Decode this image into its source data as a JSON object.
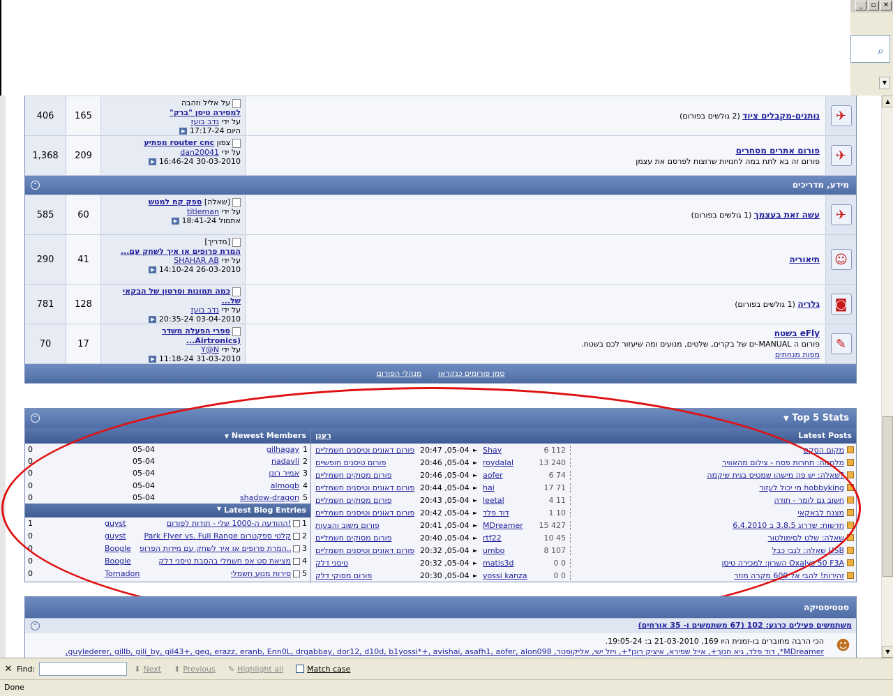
{
  "window": {
    "minimize": "_",
    "maximize": "▫",
    "close": "✕"
  },
  "forum_rows_a": [
    {
      "title": "נותנים-מקבלים ציוד",
      "viewers": "(2 גולשים בפורום)",
      "desc": "",
      "last_line1": "על אליל וזהבה",
      "last_title": "למסירה טיסן \"ברק\"",
      "last_by_prefix": "על ידי",
      "last_by": "נדב בועז",
      "last_date": "היום",
      "last_time": "17:17-24",
      "threads": "165",
      "posts": "406"
    },
    {
      "title": "פורום אתרים מסחרים",
      "viewers": "",
      "desc": "פורום זה בא לתת במה לחנויות שרוצות לפרסם את עצמן",
      "last_line1": "צפון",
      "last_title": "router cnc מפתיע",
      "last_by_prefix": "על ידי",
      "last_by": "dan20041",
      "last_date": "30-03-2010",
      "last_time": "16:46-24",
      "threads": "209",
      "posts": "1,368"
    }
  ],
  "category": {
    "title": "מידע, מדריכים",
    "collapse": "⌃"
  },
  "forum_rows_b": [
    {
      "title": "עשה זאת בעצמך",
      "viewers": "(1 גולשים בפורום)",
      "desc": "",
      "desc2": "",
      "prefix": "[שאלה]",
      "last_title": "ספק קח למטש",
      "last_by_prefix": "על ידי",
      "last_by": "titleman",
      "last_date": "אתמול",
      "last_time": "18:41-24",
      "threads": "60",
      "posts": "585"
    },
    {
      "title": "תיאוריה",
      "viewers": "",
      "desc": "",
      "desc2": "",
      "prefix": "[מדריך]",
      "last_title": "המרת פרופים או איך לשחק עם...",
      "last_by_prefix": "על ידי",
      "last_by": "SHAHAR AB",
      "last_date": "26-03-2010",
      "last_time": "14:10-24",
      "threads": "41",
      "posts": "290"
    },
    {
      "title": "גלריה",
      "viewers": "(1 גולשים בפורום)",
      "desc": "",
      "desc2": "",
      "prefix": "",
      "last_title": "כמה תמונות וסרטון של הבקאי של...",
      "last_by_prefix": "על ידי",
      "last_by": "נדב בועז",
      "last_date": "03-04-2010",
      "last_time": "20:35-24",
      "threads": "128",
      "posts": "781"
    },
    {
      "title": "eFly בשטח",
      "viewers": "",
      "desc": "פורום ה MANUAL-ים של בקרים, שלטים, מנועים ומה שיעזור לכם בשטח.",
      "desc2": "מפות מנחתים",
      "prefix": "",
      "last_title": "ספרי הפעלה משדר (Airtronics...",
      "last_by_prefix": "על ידי",
      "last_by": "Y@N",
      "last_date": "31-03-2010",
      "last_time": "11:18-24",
      "threads": "17",
      "posts": "70"
    }
  ],
  "footer_links": [
    "מנהלי הפורום",
    "סמן פורומים כנקראו"
  ],
  "stats": {
    "title": "Top 5 Stats",
    "latest_posts_label": "Latest Posts",
    "newest_members_label": "Newest Members",
    "latest_blog_label": "Latest Blog Entries",
    "forum_header": "רענן",
    "posts": [
      {
        "n": "6 112",
        "user": "Shay",
        "time": "20:47 ,05-04",
        "forum": "פורום דאונים וטיסנים חשמליים",
        "title": "מקום הסקס"
      },
      {
        "n": "13 240",
        "user": "roydalal",
        "time": "20:46 ,05-04",
        "forum": "פורום טיסנים חופשיים",
        "title": "מלחמה: תחרות פסח - צילום מהאוויר"
      },
      {
        "n": "6 74",
        "user": "aofer",
        "time": "20:46 ,05-04",
        "forum": "פורום מסוקים חשמליים",
        "title": "שאלה: יש פה מישהו שמטיס בגית שיקמה?"
      },
      {
        "n": "17 71",
        "user": "hai",
        "time": "20:44 ,05-04",
        "forum": "פורום דאונים וטיסנים חשמליים",
        "title": "מי יכול לעזור hobbyking"
      },
      {
        "n": "4 11",
        "user": "leetal",
        "time": "20:43 ,05-04",
        "forum": "פורום מסוקים חשמליים",
        "title": "חשוב גם לומר - תודה"
      },
      {
        "n": "1 10",
        "user": "דוד פלד",
        "time": "20:42 ,05-04",
        "forum": "פורום דאונים וטיסנים חשמליים",
        "title": "מצנח לבאקאי"
      },
      {
        "n": "15 427",
        "user": "MDreamer",
        "time": "20:41 ,05-04",
        "forum": "פורום משוב והצעות",
        "title": "חדשות: שדרוג 3.8.5 ב 6.4.2010"
      },
      {
        "n": "10 45",
        "user": "rtf22",
        "time": "20:40 ,05-04",
        "forum": "פורום מסוקים חשמליים",
        "title": "שאלה: שלט לסימולטור"
      },
      {
        "n": "8 107",
        "user": "umbo",
        "time": "20:32 ,05-04",
        "forum": "פורום דאונים וטיסנים חשמליים",
        "title": "שאלה: לגבי כבל USB"
      },
      {
        "n": "0 0",
        "user": "matis3d",
        "time": "20:32 ,05-04",
        "forum": "טיסני דלק",
        "title": "השרון: למכירה טיסן Oxalys 50 F3A"
      },
      {
        "n": "0 0",
        "user": "yossi kanza",
        "time": "20:30 ,05-04",
        "forum": "פורום מסוקי דלק",
        "title": "זהירות! להבי אל 600 מקרה מוזר"
      }
    ],
    "members": [
      {
        "posts": "0",
        "date": "05-04",
        "name": "gilhagay",
        "rank": "1"
      },
      {
        "posts": "0",
        "date": "05-04",
        "name": "nadavli",
        "rank": "2"
      },
      {
        "posts": "0",
        "date": "05-04",
        "name": "אמיר רונן",
        "rank": "3"
      },
      {
        "posts": "0",
        "date": "05-04",
        "name": "almogb",
        "rank": "4"
      },
      {
        "posts": "0",
        "date": "05-04",
        "name": "shadow-dragon",
        "rank": "5"
      }
    ],
    "blogs": [
      {
        "c": "1",
        "user": "guyst",
        "title": "ההודעה ה-1000 שלי - תודות לפורום!",
        "rank": "1"
      },
      {
        "c": "0",
        "user": "guyst",
        "title": "Park Flyer vs. Full Range קלטי ספקטרום",
        "rank": "2"
      },
      {
        "c": "0",
        "user": "Boogle",
        "title": "המרת פרופים או איך לשחק עם מידות הפרופ...",
        "rank": "3"
      },
      {
        "c": "0",
        "user": "Boogle",
        "title": "מציאת סט אפ חשמלי בהסבת טיסני דלק",
        "rank": "4"
      },
      {
        "c": "0",
        "user": "Tornadon",
        "title": "סירות מנוע חשמלי",
        "rank": "5"
      }
    ]
  },
  "site_stats": {
    "title": "סטטיסטיקה",
    "active_users": "משתמשים פעילים כרגע: 102 (67 משתמשים ו- 35 אורחים)",
    "record": "הכי הרבה מחוברים בו-זמנית היו 169, 21-03-2010 ב: 19:05-24.",
    "users_line": "MDreamer*, דוד פלד, גיא חנוך+, אייל שפירא, איציק רונן*+, ויזל ישי, אליקופטר, guylederer, gillb, gili_by, gil43+, geg, erazz, eranb, Enn0L, drgabbay, dor12, d10d, b1yossi*+, avishai, asafh1, aofer, alon098,"
  },
  "find": {
    "close": "✕",
    "label": "Find:",
    "value": "",
    "next": "Next",
    "previous": "Previous",
    "highlight": "Highlight all",
    "match_case": "Match case"
  },
  "status": "Done",
  "colors": {
    "header_blue": "#5a77ad",
    "link": "#22229c",
    "highlight_ellipse": "#e01010"
  }
}
